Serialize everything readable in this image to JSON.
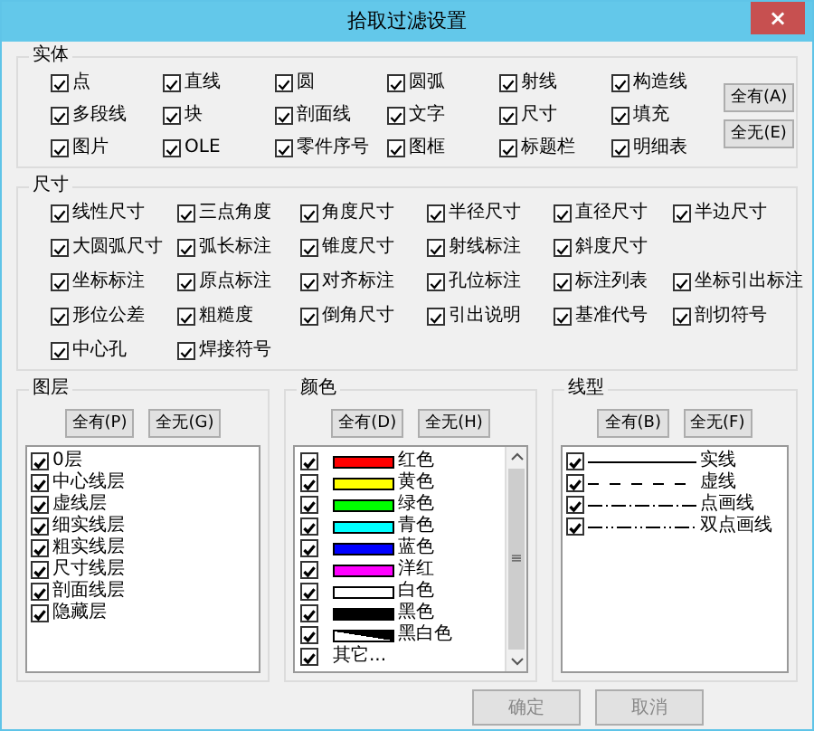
{
  "window": {
    "title": "拾取过滤设置",
    "close": "×"
  },
  "entity": {
    "title": "实体",
    "buttons": [
      "全有(A)",
      "全无(E)"
    ],
    "items": [
      {
        "label": "点",
        "checked": true
      },
      {
        "label": "直线",
        "checked": true
      },
      {
        "label": "圆",
        "checked": true
      },
      {
        "label": "圆弧",
        "checked": true
      },
      {
        "label": "射线",
        "checked": true
      },
      {
        "label": "构造线",
        "checked": true
      },
      {
        "label": "多段线",
        "checked": true
      },
      {
        "label": "块",
        "checked": true
      },
      {
        "label": "剖面线",
        "checked": true
      },
      {
        "label": "文字",
        "checked": true
      },
      {
        "label": "尺寸",
        "checked": true
      },
      {
        "label": "填充",
        "checked": true
      },
      {
        "label": "图片",
        "checked": true
      },
      {
        "label": "OLE",
        "checked": true
      },
      {
        "label": "零件序号",
        "checked": true
      },
      {
        "label": "图框",
        "checked": true
      },
      {
        "label": "标题栏",
        "checked": true
      },
      {
        "label": "明细表",
        "checked": true
      }
    ]
  },
  "dimension": {
    "title": "尺寸",
    "rows": [
      [
        {
          "label": "线性尺寸",
          "checked": true
        },
        {
          "label": "三点角度",
          "checked": true
        },
        {
          "label": "角度尺寸",
          "checked": true
        },
        {
          "label": "半径尺寸",
          "checked": true
        },
        {
          "label": "直径尺寸",
          "checked": true
        },
        {
          "label": "半边尺寸",
          "checked": true
        }
      ],
      [
        {
          "label": "大圆弧尺寸",
          "checked": true
        },
        {
          "label": "弧长标注",
          "checked": true
        },
        {
          "label": "锥度尺寸",
          "checked": true
        },
        {
          "label": "射线标注",
          "checked": true
        },
        {
          "label": "斜度尺寸",
          "checked": true
        }
      ],
      [
        {
          "label": "坐标标注",
          "checked": true
        },
        {
          "label": "原点标注",
          "checked": true
        },
        {
          "label": "对齐标注",
          "checked": true
        },
        {
          "label": "孔位标注",
          "checked": true
        },
        {
          "label": "标注列表",
          "checked": true
        },
        {
          "label": "坐标引出标注",
          "checked": true
        }
      ],
      [
        {
          "label": "形位公差",
          "checked": true
        },
        {
          "label": "粗糙度",
          "checked": true
        },
        {
          "label": "倒角尺寸",
          "checked": true
        },
        {
          "label": "引出说明",
          "checked": true
        },
        {
          "label": "基准代号",
          "checked": true
        },
        {
          "label": "剖切符号",
          "checked": true
        }
      ],
      [
        {
          "label": "中心孔",
          "checked": true
        },
        {
          "label": "焊接符号",
          "checked": true
        }
      ]
    ]
  },
  "layers": {
    "title": "图层",
    "buttons": [
      "全有(P)",
      "全无(G)"
    ],
    "items": [
      {
        "label": "0层",
        "checked": true
      },
      {
        "label": "中心线层",
        "checked": true
      },
      {
        "label": "虚线层",
        "checked": true
      },
      {
        "label": "细实线层",
        "checked": true
      },
      {
        "label": "粗实线层",
        "checked": true
      },
      {
        "label": "尺寸线层",
        "checked": true
      },
      {
        "label": "剖面线层",
        "checked": true
      },
      {
        "label": "隐藏层",
        "checked": true
      }
    ]
  },
  "colors": {
    "title": "颜色",
    "buttons": [
      "全有(D)",
      "全无(H)"
    ],
    "items": [
      {
        "label": "红色",
        "checked": true,
        "kind": "swatch",
        "color": "#ff0000"
      },
      {
        "label": "黄色",
        "checked": true,
        "kind": "swatch",
        "color": "#ffff00"
      },
      {
        "label": "绿色",
        "checked": true,
        "kind": "swatch",
        "color": "#00ff00"
      },
      {
        "label": "青色",
        "checked": true,
        "kind": "swatch",
        "color": "#00ffff"
      },
      {
        "label": "蓝色",
        "checked": true,
        "kind": "swatch",
        "color": "#0000ff"
      },
      {
        "label": "洋红",
        "checked": true,
        "kind": "swatch",
        "color": "#ff00ff"
      },
      {
        "label": "白色",
        "checked": true,
        "kind": "swatch",
        "color": "#ffffff"
      },
      {
        "label": "黑色",
        "checked": true,
        "kind": "swatch",
        "color": "#000000"
      },
      {
        "label": "黑白色",
        "checked": true,
        "kind": "split"
      },
      {
        "label": "其它...",
        "checked": true,
        "kind": "plain"
      }
    ],
    "scroll_thumb": "≡"
  },
  "linetypes": {
    "title": "线型",
    "buttons": [
      "全有(B)",
      "全无(F)"
    ],
    "items": [
      {
        "label": "实线",
        "checked": true,
        "kind": "solid"
      },
      {
        "label": "虚线",
        "checked": true,
        "kind": "dashed"
      },
      {
        "label": "点画线",
        "checked": true,
        "kind": "dashdot"
      },
      {
        "label": "双点画线",
        "checked": true,
        "kind": "dashdotdot"
      }
    ]
  },
  "footer_buttons": [
    "确定",
    "取消"
  ]
}
